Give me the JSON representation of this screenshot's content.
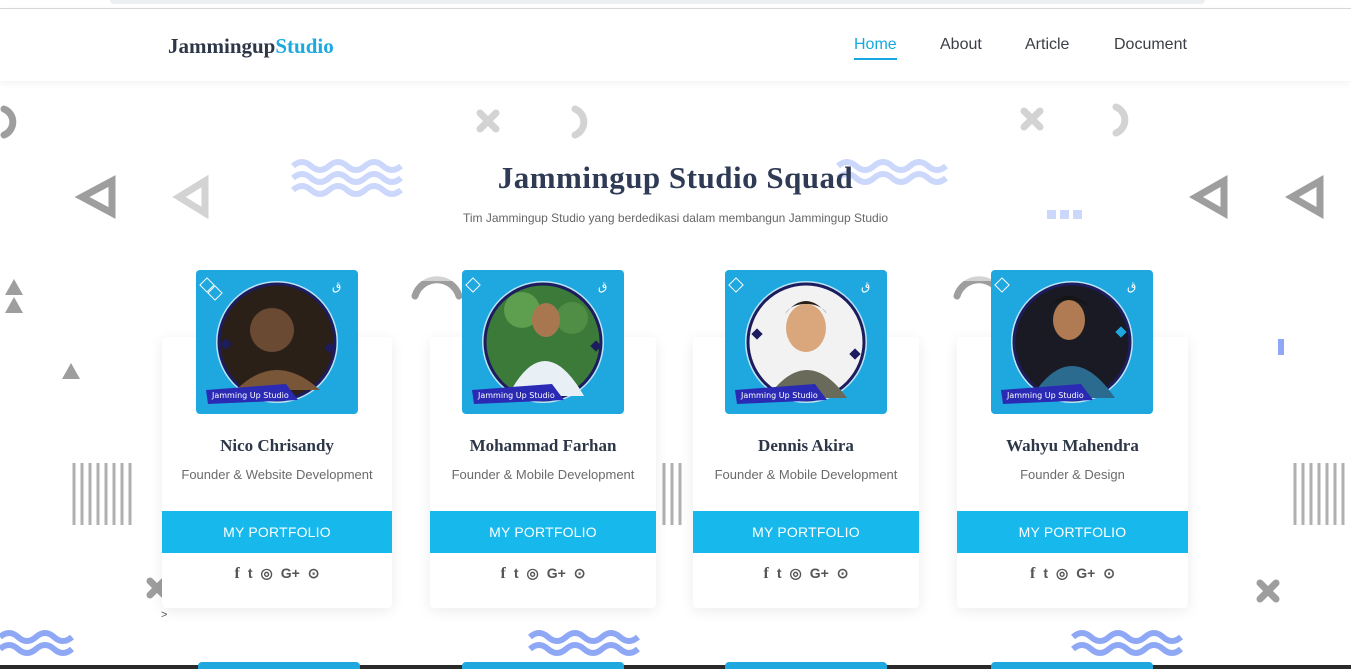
{
  "brand": {
    "part1": "Jammingup",
    "part2": "Studio"
  },
  "nav": [
    {
      "label": "Home",
      "active": true
    },
    {
      "label": "About",
      "active": false
    },
    {
      "label": "Article",
      "active": false
    },
    {
      "label": "Document",
      "active": false
    }
  ],
  "section": {
    "title": "Jammingup Studio Squad",
    "subtitle": "Tim Jammingup Studio yang berdedikasi dalam membangun Jammingup Studio"
  },
  "members": [
    {
      "name": "Nico Chrisandy",
      "role": "Founder & Website Development",
      "button": "MY PORTFOLIO",
      "photo_label": "Jamming Up Studio"
    },
    {
      "name": "Mohammad Farhan",
      "role": "Founder & Mobile Development",
      "button": "MY PORTFOLIO",
      "photo_label": "Jamming Up Studio"
    },
    {
      "name": "Dennis Akira",
      "role": "Founder & Mobile Development",
      "button": "MY PORTFOLIO",
      "photo_label": "Jamming Up Studio"
    },
    {
      "name": "Wahyu Mahendra",
      "role": "Founder & Design",
      "button": "MY PORTFOLIO",
      "photo_label": "Jamming Up Studio"
    }
  ],
  "social_icons": [
    "facebook-icon",
    "twitter-icon",
    "instagram-icon",
    "google-plus-icon",
    "github-icon"
  ],
  "social_glyphs": {
    "facebook": "f",
    "twitter": "t",
    "instagram": "◎",
    "googleplus": "G+",
    "github": "⊙"
  },
  "colors": {
    "accent": "#17b9ed",
    "brand_dark": "#2d3748",
    "photo_bg": "#1fa8e0"
  }
}
